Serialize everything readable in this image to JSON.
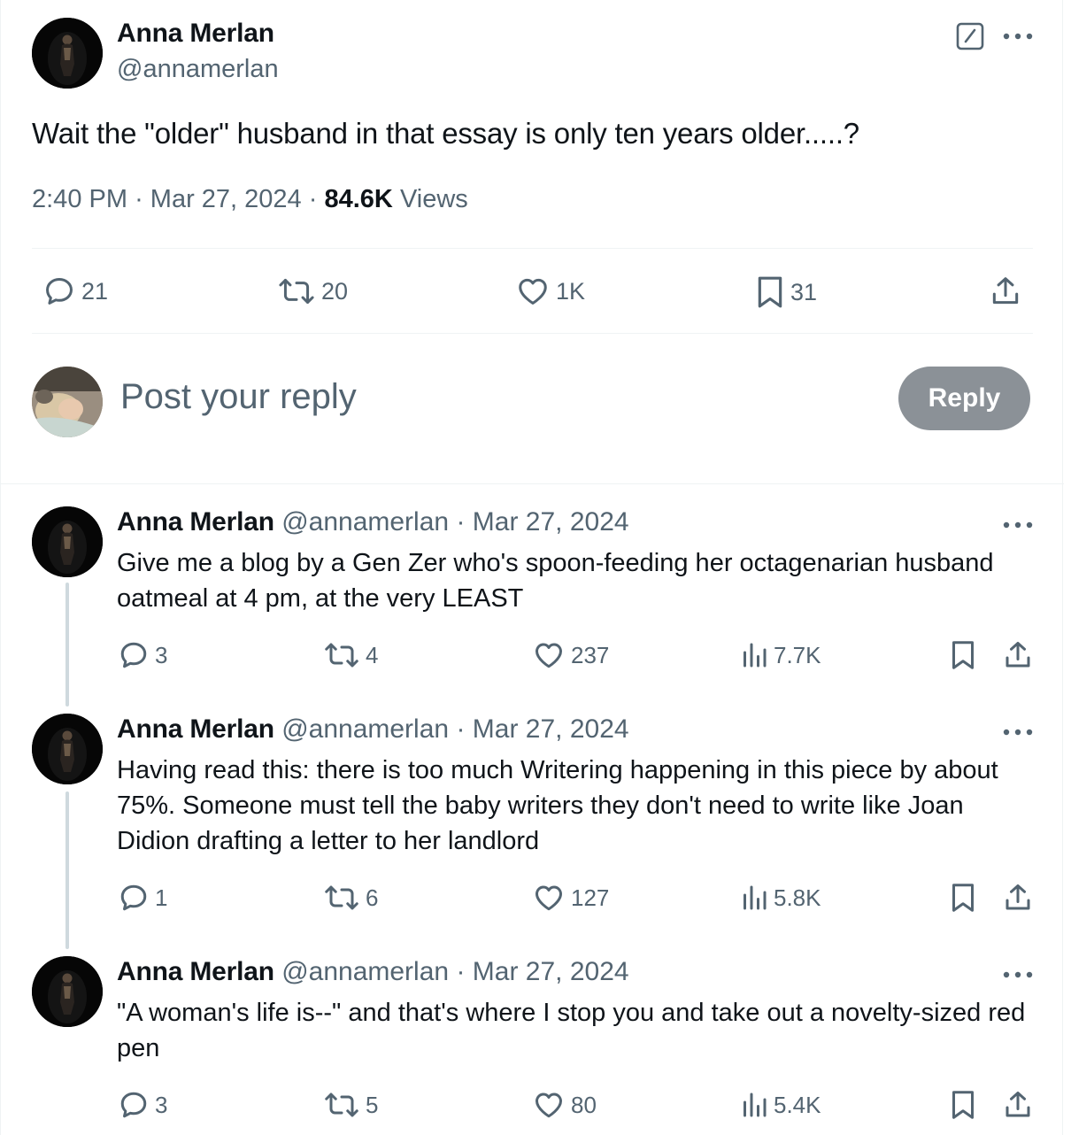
{
  "main_post": {
    "author_name": "Anna Merlan",
    "author_handle": "@annamerlan",
    "text": "Wait the \"older\" husband in that essay is only ten years older.....?",
    "time": "2:40 PM",
    "date": "Mar 27, 2024",
    "views_count": "84.6K",
    "views_label": "Views",
    "separator": "·",
    "actions": {
      "replies": "21",
      "reposts": "20",
      "likes": "1K",
      "bookmarks": "31"
    }
  },
  "composer": {
    "placeholder": "Post your reply",
    "button_label": "Reply"
  },
  "replies": [
    {
      "author_name": "Anna Merlan",
      "author_handle": "@annamerlan",
      "date": "Mar 27, 2024",
      "text": "Give me a blog by a Gen Zer who's spoon-feeding her octagenarian husband oatmeal at 4 pm, at the very LEAST",
      "replies": "3",
      "reposts": "4",
      "likes": "237",
      "views": "7.7K"
    },
    {
      "author_name": "Anna Merlan",
      "author_handle": "@annamerlan",
      "date": "Mar 27, 2024",
      "text": "Having read this: there is too much Writering happening in this piece by about 75%. Someone must tell the baby writers they don't need to write like Joan Didion drafting a letter to her landlord",
      "replies": "1",
      "reposts": "6",
      "likes": "127",
      "views": "5.8K"
    },
    {
      "author_name": "Anna Merlan",
      "author_handle": "@annamerlan",
      "date": "Mar 27, 2024",
      "text": "\"A woman's life is--\" and that's where I stop you and take out a novelty-sized red pen",
      "replies": "3",
      "reposts": "5",
      "likes": "80",
      "views": "5.4K"
    }
  ],
  "icons": {
    "grok": "grok-icon",
    "more": "more-icon",
    "reply": "reply-icon",
    "repost": "repost-icon",
    "like": "heart-icon",
    "bookmark": "bookmark-icon",
    "share": "share-icon",
    "views": "views-icon"
  },
  "colors": {
    "text_primary": "#0f1419",
    "text_secondary": "#536471",
    "reply_button_bg": "#8b9197",
    "divider": "#eff3f4",
    "thread_line": "#cfd9de"
  }
}
